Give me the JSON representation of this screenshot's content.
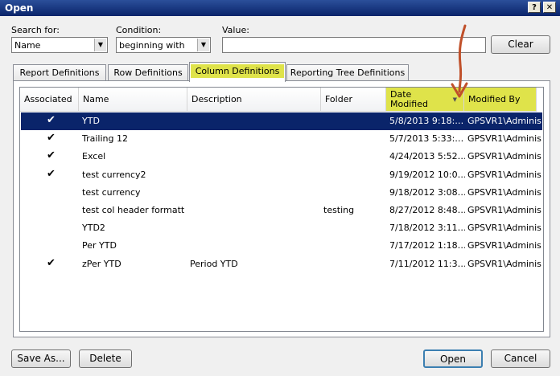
{
  "window": {
    "title": "Open",
    "help_label": "?",
    "close_label": "✕"
  },
  "search": {
    "search_for_label": "Search for:",
    "search_for_value": "Name",
    "condition_label": "Condition:",
    "condition_value": "beginning with",
    "value_label": "Value:",
    "value_text": "",
    "clear_label": "Clear"
  },
  "tabs": [
    {
      "label": "Report Definitions"
    },
    {
      "label": "Row Definitions"
    },
    {
      "label": "Column Definitions"
    },
    {
      "label": "Reporting Tree Definitions"
    }
  ],
  "table": {
    "columns": [
      "Associated",
      "Name",
      "Description",
      "Folder",
      "Date Modified",
      "Modified By"
    ],
    "rows": [
      {
        "associated": "✔",
        "name": "YTD",
        "description": "",
        "folder": "",
        "date": "5/8/2013 9:18:…",
        "by": "GPSVR1\\Adminis…"
      },
      {
        "associated": "✔",
        "name": "Trailing 12",
        "description": "",
        "folder": "",
        "date": "5/7/2013 5:33:…",
        "by": "GPSVR1\\Adminis…"
      },
      {
        "associated": "✔",
        "name": "Excel",
        "description": "",
        "folder": "",
        "date": "4/24/2013 5:52…",
        "by": "GPSVR1\\Adminis…"
      },
      {
        "associated": "✔",
        "name": "test currency2",
        "description": "",
        "folder": "",
        "date": "9/19/2012 10:0…",
        "by": "GPSVR1\\Adminis…"
      },
      {
        "associated": "",
        "name": "test currency",
        "description": "",
        "folder": "",
        "date": "9/18/2012 3:08…",
        "by": "GPSVR1\\Adminis…"
      },
      {
        "associated": "",
        "name": "test col header formatting",
        "description": "",
        "folder": "testing",
        "date": "8/27/2012 8:48…",
        "by": "GPSVR1\\Adminis…"
      },
      {
        "associated": "",
        "name": "YTD2",
        "description": "",
        "folder": "",
        "date": "7/18/2012 3:11…",
        "by": "GPSVR1\\Adminis…"
      },
      {
        "associated": "",
        "name": "Per YTD",
        "description": "",
        "folder": "",
        "date": "7/17/2012 1:18…",
        "by": "GPSVR1\\Adminis…"
      },
      {
        "associated": "✔",
        "name": "zPer YTD",
        "description": "Period YTD",
        "folder": "",
        "date": "7/11/2012 11:3…",
        "by": "GPSVR1\\Adminis…"
      }
    ]
  },
  "footer": {
    "save_as_label": "Save As...",
    "delete_label": "Delete",
    "open_label": "Open",
    "cancel_label": "Cancel"
  },
  "colors": {
    "selection": "#0a246a",
    "highlight": "#dfe34a",
    "annotation": "#c0502a"
  }
}
